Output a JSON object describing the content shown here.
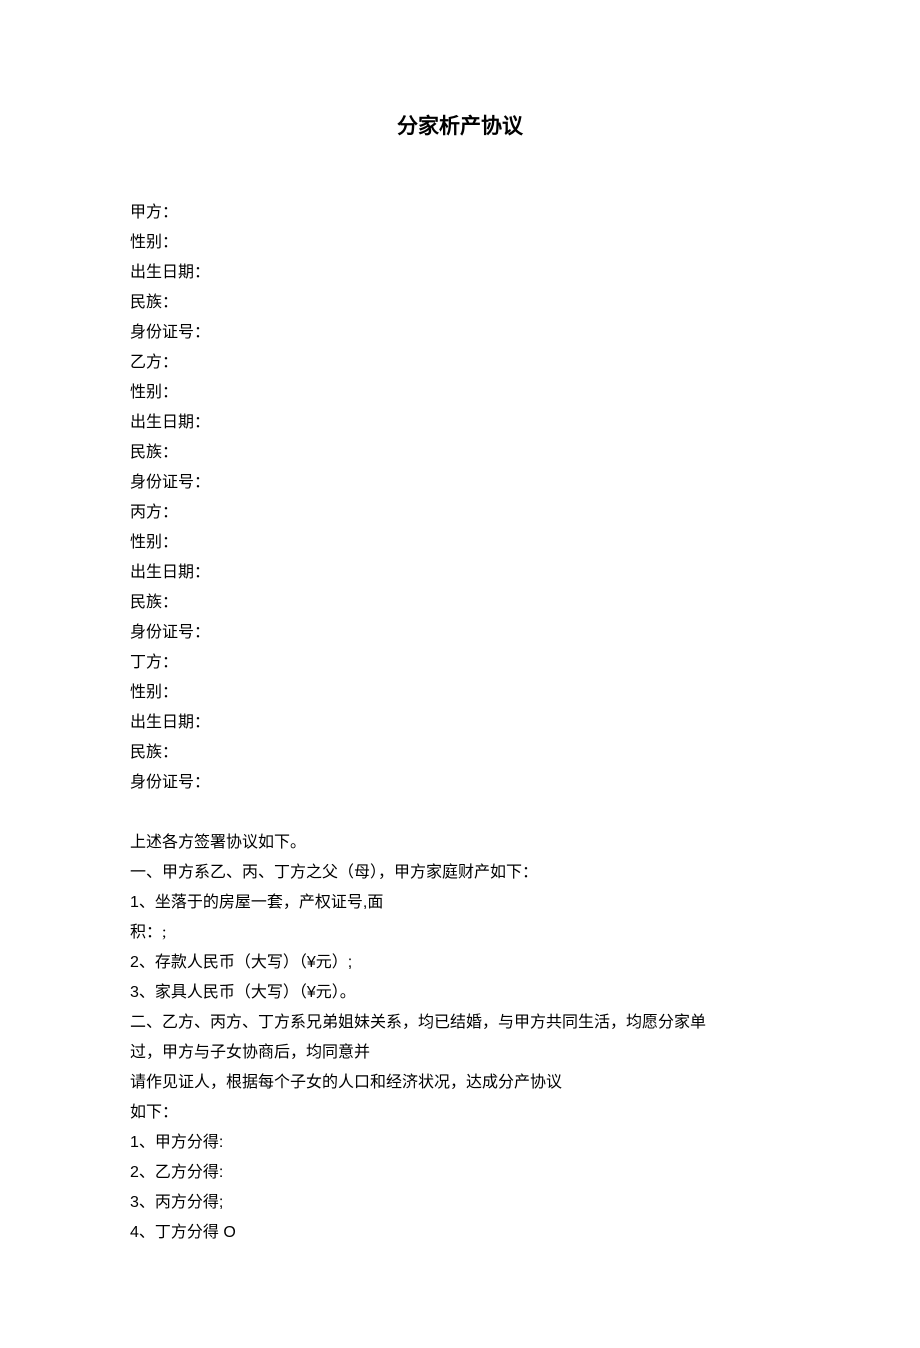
{
  "title": "分家析产协议",
  "parties": {
    "jia": {
      "label": "甲方：",
      "gender": "性别：",
      "birth": "出生日期：",
      "ethnicity": "民族：",
      "id": "身份证号："
    },
    "yi": {
      "label": "乙方：",
      "gender": "性别：",
      "birth": "出生日期：",
      "ethnicity": "民族：",
      "id": "身份证号："
    },
    "bing": {
      "label": "丙方：",
      "gender": "性别：",
      "birth": "出生日期：",
      "ethnicity": "民族：",
      "id": "身份证号："
    },
    "ding": {
      "label": "丁方：",
      "gender": "性别：",
      "birth": "出生日期：",
      "ethnicity": "民族：",
      "id": "身份证号："
    }
  },
  "body": {
    "intro": "上述各方签署协议如下。",
    "section1_title": "一、甲方系乙、丙、丁方之父（母），甲方家庭财产如下：",
    "section1_item1a": "1、坐落于的房屋一套，产权证号,面",
    "section1_item1b": "积：;",
    "section1_item2": "2、存款人民币（大写）（¥元）;",
    "section1_item3": "3、家具人民币（大写）（¥元）。",
    "section2_line1": "二、乙方、丙方、丁方系兄弟姐妹关系，均已结婚，与甲方共同生活，均愿分家单",
    "section2_line2": "过，甲方与子女协商后，均同意并",
    "section2_line3": "请作见证人，根据每个子女的人口和经济状况，达成分产协议",
    "section2_line4": "如下：",
    "dist1": "1、甲方分得:",
    "dist2": "2、乙方分得:",
    "dist3": "3、丙方分得;",
    "dist4": "4、丁方分得 O"
  }
}
